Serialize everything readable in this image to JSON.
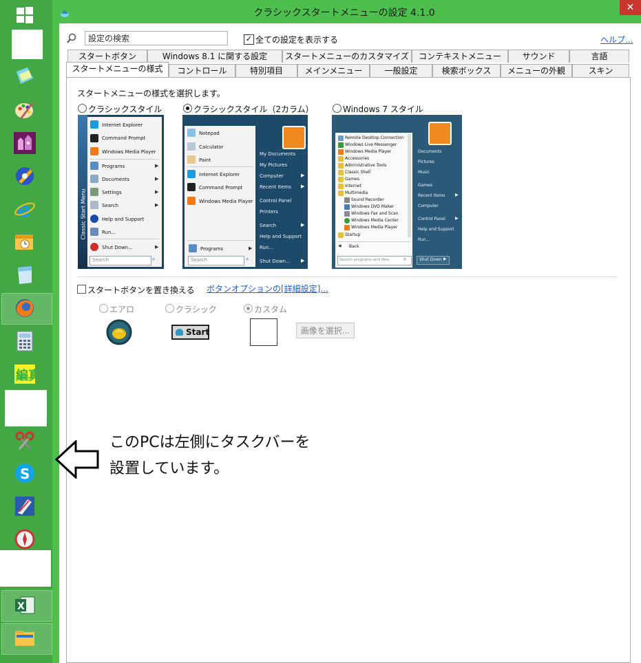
{
  "window": {
    "title": "クラシックスタートメニューの設定 4.1.0",
    "close_glyph": "✕"
  },
  "search": {
    "placeholder": "設定の検索",
    "show_all_label": "全ての設定を表示する",
    "help_link": "ヘルプ..."
  },
  "tabs_row1": [
    "スタートボタン",
    "Windows 8.1 に関する設定",
    "スタートメニューのカスタマイズ",
    "コンテキストメニュー",
    "サウンド",
    "言語"
  ],
  "tabs_row2": [
    "スタートメニューの様式",
    "コントロール",
    "特別項目",
    "メインメニュー",
    "一般設定",
    "検索ボックス",
    "メニューの外観",
    "スキン"
  ],
  "panel": {
    "instruction": "スタートメニューの様式を選択します。",
    "styles": [
      {
        "label": "クラシックスタイル",
        "selected": false
      },
      {
        "label": "クラシックスタイル（2カラム）",
        "selected": true
      },
      {
        "label": "Windows 7 スタイル",
        "selected": false
      }
    ],
    "replace_button_label": "スタートボタンを置き換える",
    "button_options_link": "ボタンオプションの[詳細設定]...",
    "button_styles": [
      {
        "label": "エアロ",
        "selected": false
      },
      {
        "label": "クラシック",
        "selected": false
      },
      {
        "label": "カスタム",
        "selected": true
      }
    ],
    "start_button_text": "Start",
    "select_image_button": "画像を選択..."
  },
  "preview_classic": {
    "items": [
      "Internet Explorer",
      "Command Prompt",
      "Windows Media Player",
      "Programs",
      "Documents",
      "Settings",
      "Search",
      "Help and Support",
      "Run...",
      "Shut Down..."
    ],
    "banner": "Classic Start Menu",
    "search_placeholder": "Search"
  },
  "preview_two_column": {
    "left_items": [
      "Notepad",
      "Calculator",
      "Paint",
      "Internet Explorer",
      "Command Prompt",
      "Windows Media Player"
    ],
    "programs": "Programs",
    "search_placeholder": "Search",
    "right_items": [
      "My Documents",
      "My Pictures",
      "Computer",
      "Recent Items",
      "Control Panel",
      "Printers",
      "Search",
      "Help and Support",
      "Run..."
    ],
    "shutdown": "Shut Down..."
  },
  "preview_win7": {
    "left_items": [
      "Remote Desktop Connection",
      "Windows Live Messenger",
      "Windows Media Player",
      "Accessories",
      "Administrative Tools",
      "Classic Shell",
      "Games",
      "Internet",
      "Multimedia",
      "Sound Recorder",
      "Windows DVD Maker",
      "Windows Fax and Scan",
      "Windows Media Center",
      "Windows Media Player",
      "Startup"
    ],
    "back": "Back",
    "search_placeholder": "Search programs and files",
    "right_items": [
      "Documents",
      "Pictures",
      "Music",
      "Games",
      "Recent Items",
      "Computer",
      "Control Panel",
      "Help and Support",
      "Run..."
    ],
    "shutdown": "Shut Down"
  },
  "annotation": {
    "line1": "このPCは左側にタスクバーを",
    "line2": "設置しています。"
  },
  "taskbar_icons": [
    "windows-start-icon",
    "tiles-icon",
    "paint-palette-icon",
    "game-castle-icon",
    "media-player-icon",
    "internet-explorer-icon",
    "outlook-calendar-icon",
    "notepad-icon",
    "firefox-icon",
    "calculator-icon",
    "keisan-app-icon",
    "scissors-tool-icon",
    "skype-icon",
    "drawing-app-icon",
    "compass-icon",
    "excel-icon",
    "file-explorer-icon"
  ],
  "colors": {
    "taskbar": "#43a843",
    "frame": "#4dbf4d",
    "close": "#c7372f",
    "link": "#1a5fd0"
  }
}
